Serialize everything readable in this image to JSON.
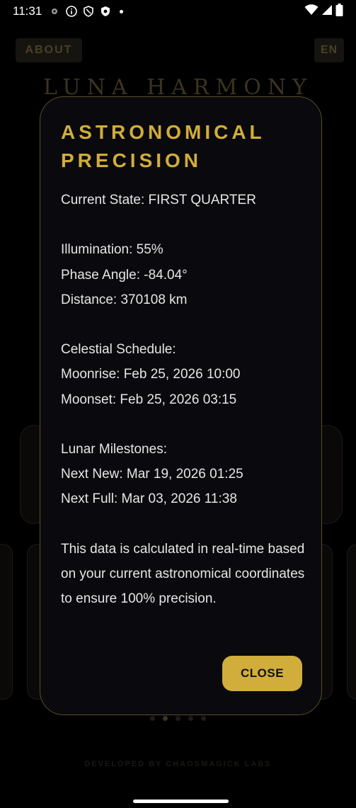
{
  "status_bar": {
    "time": "11:31",
    "icons": [
      "settings-cog-icon",
      "info-icon",
      "shield-icon",
      "shield-filled-icon"
    ],
    "right_icons": [
      "wifi-icon",
      "signal-icon",
      "battery-icon"
    ]
  },
  "app": {
    "about_label": "ABOUT",
    "lang_label": "EN",
    "title": "LUNA HARMONY",
    "footer": "DEVELOPED BY CHAOSMAGICK LABS",
    "pager_active_index": 1
  },
  "dialog": {
    "title": "ASTRONOMICAL PRECISION",
    "current_state": "Current State: FIRST QUARTER",
    "illumination": "Illumination: 55%",
    "phase_angle": "Phase Angle: -84.04°",
    "distance": "Distance: 370108 km",
    "schedule_heading": "Celestial Schedule:",
    "moonrise": "Moonrise: Feb 25, 2026 10:00",
    "moonset": "Moonset: Feb 25, 2026 03:15",
    "milestones_heading": "Lunar Milestones:",
    "next_new": "Next New: Mar 19, 2026 01:25",
    "next_full": "Next Full: Mar 03, 2026 11:38",
    "note": "This data is calculated in real-time based on your current astronomical coordinates to ensure 100% precision.",
    "close_label": "CLOSE"
  },
  "colors": {
    "accent_gold": "#d1ad3b",
    "dialog_bg": "#0a0a0e",
    "dialog_border": "#5a4e25"
  }
}
